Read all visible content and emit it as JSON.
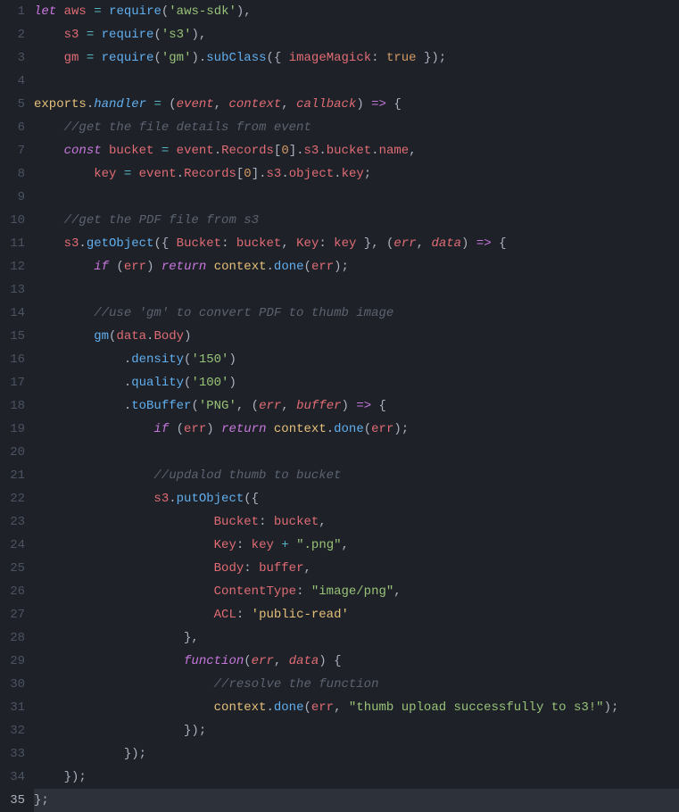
{
  "total_lines": 35,
  "active_line": 35,
  "code": {
    "l1": [
      [
        "kw",
        "let"
      ],
      [
        "pun",
        " "
      ],
      [
        "var",
        "aws"
      ],
      [
        "pun",
        " "
      ],
      [
        "op",
        "="
      ],
      [
        "pun",
        " "
      ],
      [
        "fn",
        "require"
      ],
      [
        "pun",
        "("
      ],
      [
        "str",
        "'aws-sdk'"
      ],
      [
        "pun",
        "),"
      ]
    ],
    "l2": [
      [
        "pun",
        "    "
      ],
      [
        "var",
        "s3"
      ],
      [
        "pun",
        " "
      ],
      [
        "op",
        "="
      ],
      [
        "pun",
        " "
      ],
      [
        "fn",
        "require"
      ],
      [
        "pun",
        "("
      ],
      [
        "str",
        "'s3'"
      ],
      [
        "pun",
        "),"
      ]
    ],
    "l3": [
      [
        "pun",
        "    "
      ],
      [
        "var",
        "gm"
      ],
      [
        "pun",
        " "
      ],
      [
        "op",
        "="
      ],
      [
        "pun",
        " "
      ],
      [
        "fn",
        "require"
      ],
      [
        "pun",
        "("
      ],
      [
        "str",
        "'gm'"
      ],
      [
        "pun",
        ")."
      ],
      [
        "fn",
        "subClass"
      ],
      [
        "pun",
        "({ "
      ],
      [
        "prop",
        "imageMagick"
      ],
      [
        "pun",
        ": "
      ],
      [
        "num",
        "true"
      ],
      [
        "pun",
        " });"
      ]
    ],
    "l4": [],
    "l5": [
      [
        "obj",
        "exports"
      ],
      [
        "pun",
        "."
      ],
      [
        "fnI",
        "handler"
      ],
      [
        "pun",
        " "
      ],
      [
        "op",
        "="
      ],
      [
        "pun",
        " ("
      ],
      [
        "varI",
        "event"
      ],
      [
        "pun",
        ", "
      ],
      [
        "varI",
        "context"
      ],
      [
        "pun",
        ", "
      ],
      [
        "varI",
        "callback"
      ],
      [
        "pun",
        ") "
      ],
      [
        "kw",
        "=>"
      ],
      [
        "pun",
        " {"
      ]
    ],
    "l6": [
      [
        "pun",
        "    "
      ],
      [
        "cmt",
        "//get the file details from event"
      ]
    ],
    "l7": [
      [
        "pun",
        "    "
      ],
      [
        "kw",
        "const"
      ],
      [
        "pun",
        " "
      ],
      [
        "var",
        "bucket"
      ],
      [
        "pun",
        " "
      ],
      [
        "op",
        "="
      ],
      [
        "pun",
        " "
      ],
      [
        "var",
        "event"
      ],
      [
        "pun",
        "."
      ],
      [
        "prop",
        "Records"
      ],
      [
        "pun",
        "["
      ],
      [
        "num",
        "0"
      ],
      [
        "pun",
        "]."
      ],
      [
        "prop",
        "s3"
      ],
      [
        "pun",
        "."
      ],
      [
        "prop",
        "bucket"
      ],
      [
        "pun",
        "."
      ],
      [
        "prop",
        "name"
      ],
      [
        "pun",
        ","
      ]
    ],
    "l8": [
      [
        "pun",
        "        "
      ],
      [
        "var",
        "key"
      ],
      [
        "pun",
        " "
      ],
      [
        "op",
        "="
      ],
      [
        "pun",
        " "
      ],
      [
        "var",
        "event"
      ],
      [
        "pun",
        "."
      ],
      [
        "prop",
        "Records"
      ],
      [
        "pun",
        "["
      ],
      [
        "num",
        "0"
      ],
      [
        "pun",
        "]."
      ],
      [
        "prop",
        "s3"
      ],
      [
        "pun",
        "."
      ],
      [
        "prop",
        "object"
      ],
      [
        "pun",
        "."
      ],
      [
        "prop",
        "key"
      ],
      [
        "pun",
        ";"
      ]
    ],
    "l9": [],
    "l10": [
      [
        "pun",
        "    "
      ],
      [
        "cmt",
        "//get the PDF file from s3"
      ]
    ],
    "l11": [
      [
        "pun",
        "    "
      ],
      [
        "var",
        "s3"
      ],
      [
        "pun",
        "."
      ],
      [
        "fn",
        "getObject"
      ],
      [
        "pun",
        "({ "
      ],
      [
        "prop",
        "Bucket"
      ],
      [
        "pun",
        ": "
      ],
      [
        "var",
        "bucket"
      ],
      [
        "pun",
        ", "
      ],
      [
        "prop",
        "Key"
      ],
      [
        "pun",
        ": "
      ],
      [
        "var",
        "key"
      ],
      [
        "pun",
        " }, ("
      ],
      [
        "varI",
        "err"
      ],
      [
        "pun",
        ", "
      ],
      [
        "varI",
        "data"
      ],
      [
        "pun",
        ") "
      ],
      [
        "kw",
        "=>"
      ],
      [
        "pun",
        " {"
      ]
    ],
    "l12": [
      [
        "pun",
        "        "
      ],
      [
        "kw",
        "if"
      ],
      [
        "pun",
        " ("
      ],
      [
        "var",
        "err"
      ],
      [
        "pun",
        ") "
      ],
      [
        "kw",
        "return"
      ],
      [
        "pun",
        " "
      ],
      [
        "obj",
        "context"
      ],
      [
        "pun",
        "."
      ],
      [
        "fn",
        "done"
      ],
      [
        "pun",
        "("
      ],
      [
        "var",
        "err"
      ],
      [
        "pun",
        ");"
      ]
    ],
    "l13": [],
    "l14": [
      [
        "pun",
        "        "
      ],
      [
        "cmt",
        "//use 'gm' to convert PDF to thumb image"
      ]
    ],
    "l15": [
      [
        "pun",
        "        "
      ],
      [
        "fn",
        "gm"
      ],
      [
        "pun",
        "("
      ],
      [
        "var",
        "data"
      ],
      [
        "pun",
        "."
      ],
      [
        "prop",
        "Body"
      ],
      [
        "pun",
        ")"
      ]
    ],
    "l16": [
      [
        "pun",
        "            ."
      ],
      [
        "fn",
        "density"
      ],
      [
        "pun",
        "("
      ],
      [
        "str",
        "'150'"
      ],
      [
        "pun",
        ")"
      ]
    ],
    "l17": [
      [
        "pun",
        "            ."
      ],
      [
        "fn",
        "quality"
      ],
      [
        "pun",
        "("
      ],
      [
        "str",
        "'100'"
      ],
      [
        "pun",
        ")"
      ]
    ],
    "l18": [
      [
        "pun",
        "            ."
      ],
      [
        "fn",
        "toBuffer"
      ],
      [
        "pun",
        "("
      ],
      [
        "str",
        "'PNG'"
      ],
      [
        "pun",
        ", ("
      ],
      [
        "varI",
        "err"
      ],
      [
        "pun",
        ", "
      ],
      [
        "varI",
        "buffer"
      ],
      [
        "pun",
        ") "
      ],
      [
        "kw",
        "=>"
      ],
      [
        "pun",
        " {"
      ]
    ],
    "l19": [
      [
        "pun",
        "                "
      ],
      [
        "kw",
        "if"
      ],
      [
        "pun",
        " ("
      ],
      [
        "var",
        "err"
      ],
      [
        "pun",
        ") "
      ],
      [
        "kw",
        "return"
      ],
      [
        "pun",
        " "
      ],
      [
        "obj",
        "context"
      ],
      [
        "pun",
        "."
      ],
      [
        "fn",
        "done"
      ],
      [
        "pun",
        "("
      ],
      [
        "var",
        "err"
      ],
      [
        "pun",
        ");"
      ]
    ],
    "l20": [],
    "l21": [
      [
        "pun",
        "                "
      ],
      [
        "cmt",
        "//updalod thumb to bucket"
      ]
    ],
    "l22": [
      [
        "pun",
        "                "
      ],
      [
        "var",
        "s3"
      ],
      [
        "pun",
        "."
      ],
      [
        "fn",
        "putObject"
      ],
      [
        "pun",
        "({"
      ]
    ],
    "l23": [
      [
        "pun",
        "                        "
      ],
      [
        "prop",
        "Bucket"
      ],
      [
        "pun",
        ": "
      ],
      [
        "var",
        "bucket"
      ],
      [
        "pun",
        ","
      ]
    ],
    "l24": [
      [
        "pun",
        "                        "
      ],
      [
        "prop",
        "Key"
      ],
      [
        "pun",
        ": "
      ],
      [
        "var",
        "key"
      ],
      [
        "pun",
        " "
      ],
      [
        "op",
        "+"
      ],
      [
        "pun",
        " "
      ],
      [
        "str",
        "\".png\""
      ],
      [
        "pun",
        ","
      ]
    ],
    "l25": [
      [
        "pun",
        "                        "
      ],
      [
        "prop",
        "Body"
      ],
      [
        "pun",
        ": "
      ],
      [
        "var",
        "buffer"
      ],
      [
        "pun",
        ","
      ]
    ],
    "l26": [
      [
        "pun",
        "                        "
      ],
      [
        "prop",
        "ContentType"
      ],
      [
        "pun",
        ": "
      ],
      [
        "str",
        "\"image/png\""
      ],
      [
        "pun",
        ","
      ]
    ],
    "l27": [
      [
        "pun",
        "                        "
      ],
      [
        "prop",
        "ACL"
      ],
      [
        "pun",
        ": "
      ],
      [
        "strY",
        "'public-read'"
      ]
    ],
    "l28": [
      [
        "pun",
        "                    },"
      ]
    ],
    "l29": [
      [
        "pun",
        "                    "
      ],
      [
        "kwf",
        "function"
      ],
      [
        "pun",
        "("
      ],
      [
        "varI",
        "err"
      ],
      [
        "pun",
        ", "
      ],
      [
        "varI",
        "data"
      ],
      [
        "pun",
        ") {"
      ]
    ],
    "l30": [
      [
        "pun",
        "                        "
      ],
      [
        "cmt",
        "//resolve the function"
      ]
    ],
    "l31": [
      [
        "pun",
        "                        "
      ],
      [
        "obj",
        "context"
      ],
      [
        "pun",
        "."
      ],
      [
        "fn",
        "done"
      ],
      [
        "pun",
        "("
      ],
      [
        "var",
        "err"
      ],
      [
        "pun",
        ", "
      ],
      [
        "str",
        "\"thumb upload successfully to s3!\""
      ],
      [
        "pun",
        ");"
      ]
    ],
    "l32": [
      [
        "pun",
        "                    });"
      ]
    ],
    "l33": [
      [
        "pun",
        "            });"
      ]
    ],
    "l34": [
      [
        "pun",
        "    });"
      ]
    ],
    "l35": [
      [
        "pun",
        "};"
      ]
    ]
  }
}
